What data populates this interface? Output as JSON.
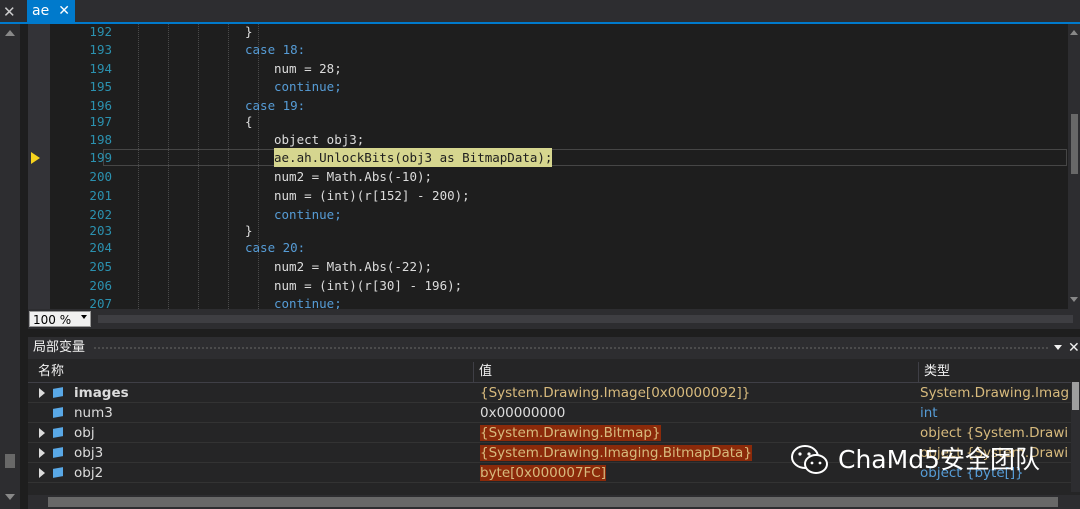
{
  "window": {
    "close_glyph": "✕"
  },
  "tab": {
    "label": "ae",
    "close_glyph": "✕"
  },
  "editor": {
    "lines": [
      {
        "n": "192",
        "text": "}"
      },
      {
        "n": "193",
        "text": "case 18:"
      },
      {
        "n": "194",
        "text": "num = 28;"
      },
      {
        "n": "195",
        "text": "continue;"
      },
      {
        "n": "196",
        "text": "case 19:"
      },
      {
        "n": "197",
        "text": "{"
      },
      {
        "n": "198",
        "text": "object obj3;"
      },
      {
        "n": "199",
        "text": "ae.ah.UnlockBits(obj3 as BitmapData);"
      },
      {
        "n": "200",
        "text": "num2 = Math.Abs(-10);"
      },
      {
        "n": "201",
        "text": "num = (int)(r[152] - 200);"
      },
      {
        "n": "202",
        "text": "continue;"
      },
      {
        "n": "203",
        "text": "}"
      },
      {
        "n": "204",
        "text": "case 20:"
      },
      {
        "n": "205",
        "text": "num2 = Math.Abs(-22);"
      },
      {
        "n": "206",
        "text": "num = (int)(r[30] - 196);"
      },
      {
        "n": "207",
        "text": "continue;"
      }
    ],
    "current_line": "199"
  },
  "zoom": {
    "value": "100 %"
  },
  "locals": {
    "title": "局部变量",
    "columns": {
      "name": "名称",
      "value": "值",
      "type": "类型"
    },
    "rows": [
      {
        "name": "images",
        "value": "{System.Drawing.Image[0x00000092]}",
        "type": "System.Drawing.Image[]",
        "expandable": true,
        "bold": true
      },
      {
        "name": "num3",
        "value": "0x00000000",
        "type": "int",
        "expandable": false
      },
      {
        "name": "obj",
        "value": "{System.Drawing.Bitmap}",
        "type": "object {System.Drawing.Bitmap}",
        "expandable": true
      },
      {
        "name": "obj3",
        "value": "{System.Drawing.Imaging.BitmapData}",
        "type": "object {System.Drawing.Imaging.BitmapData}",
        "expandable": true
      },
      {
        "name": "obj2",
        "value": "byte[0x000007FC]",
        "type": "object {byte[]}",
        "expandable": true
      }
    ]
  },
  "watermark": {
    "text": "ChaMd5安全团队"
  },
  "colors": {
    "accent": "#007acc",
    "line_number": "#2b91af",
    "keyword": "#569cd6",
    "type": "#4ec9b0",
    "current_highlight": "#d6d68f",
    "changed_value_bg": "#8b2a0a"
  }
}
